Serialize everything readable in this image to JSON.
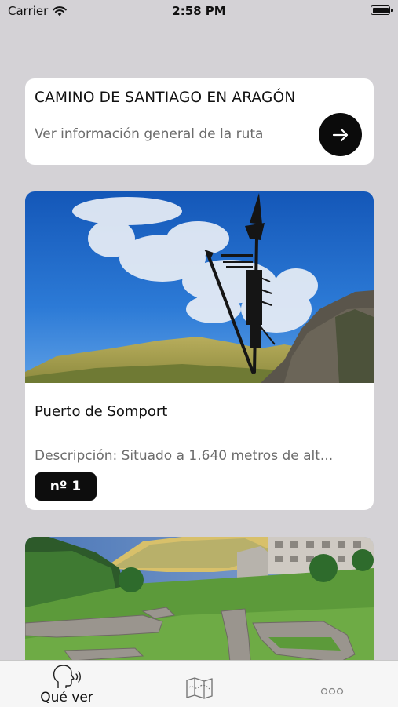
{
  "status_bar": {
    "carrier": "Carrier",
    "time": "2:58 PM",
    "wifi_icon": "wifi-icon",
    "battery_icon": "battery-icon"
  },
  "route_card": {
    "title": "CAMINO DE SANTIAGO EN ARAGÓN",
    "subtitle": "Ver información general de la ruta",
    "arrow_icon": "arrow-right-icon"
  },
  "poi_list": [
    {
      "name": "Puerto de Somport",
      "description": "Descripción: Situado a 1.640 metros de alt...",
      "badge": "nº 1",
      "image": "mountain-pass-sculpture-photo"
    },
    {
      "image": "stone-ruins-village-photo"
    }
  ],
  "tab_bar": {
    "tabs": [
      {
        "label": "Qué ver",
        "icon": "speaking-head-icon",
        "selected": true
      },
      {
        "label": "",
        "icon": "map-icon",
        "selected": false
      },
      {
        "label": "",
        "icon": "more-dots-icon",
        "selected": false
      }
    ]
  },
  "colors": {
    "background": "#d4d2d6",
    "card": "#ffffff",
    "accent": "#0b0b0b",
    "secondary_text": "#6c6c6c"
  }
}
